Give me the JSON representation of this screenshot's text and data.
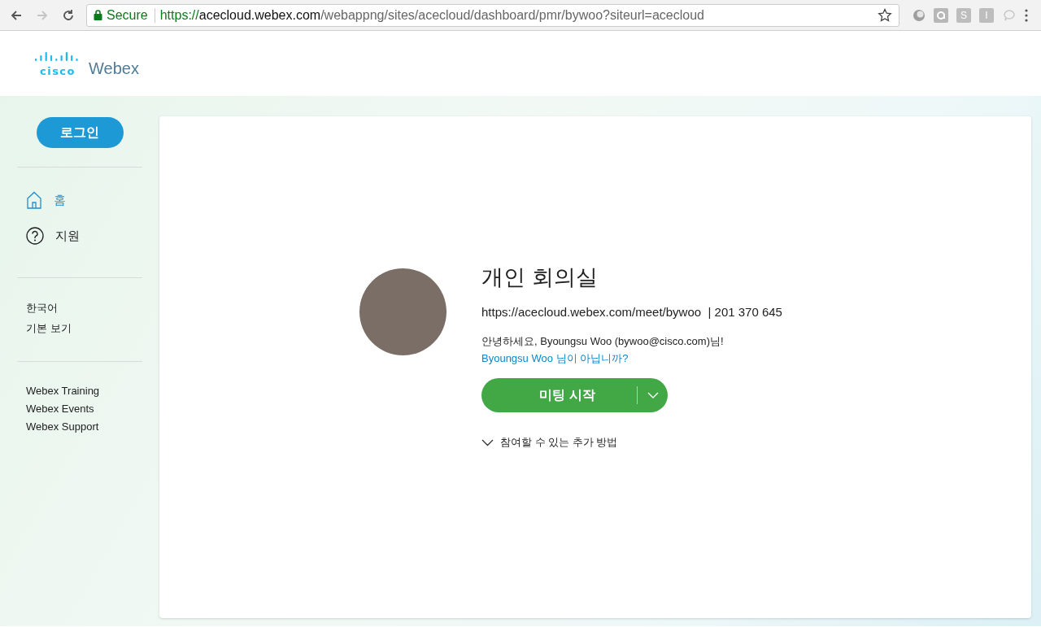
{
  "browser": {
    "nav": [
      {
        "kind": "back",
        "disabled": false
      },
      {
        "kind": "forward",
        "disabled": true
      },
      {
        "kind": "reload",
        "disabled": false
      }
    ],
    "secure_label": "Secure",
    "url": {
      "scheme": "https://",
      "host": "acecloud.webex.com",
      "path": "/webappng/sites/acecloud/dashboard/pmr/bywoo?siteurl=acecloud"
    },
    "extensions": [
      {
        "kind": "orb"
      },
      {
        "kind": "at"
      },
      {
        "kind": "letter",
        "label": "S"
      },
      {
        "kind": "letter",
        "label": "I"
      },
      {
        "kind": "bubble"
      }
    ]
  },
  "header": {
    "logo_word": "cisco",
    "logo_brand": "Webex"
  },
  "sidebar": {
    "login_button": "로그인",
    "nav": [
      {
        "kind": "home",
        "label": "홈",
        "selected": true
      },
      {
        "kind": "help",
        "label": "지원",
        "selected": false
      }
    ],
    "settings": [
      "한국어",
      "기본 보기"
    ],
    "links": [
      "Webex Training",
      "Webex Events",
      "Webex Support"
    ]
  },
  "room": {
    "title": "개인 회의실",
    "url": "https://acecloud.webex.com/meet/bywoo",
    "separator": "|",
    "number": "201 370 645",
    "greeting": "안녕하세요, Byoungsu Woo (bywoo@cisco.com)님!",
    "not_you_link": "Byoungsu Woo 님이 아닙니까?",
    "start_button": "미팅 시작",
    "more_ways": "참여할 수 있는 추가 방법",
    "more_ways_expanded": false
  }
}
